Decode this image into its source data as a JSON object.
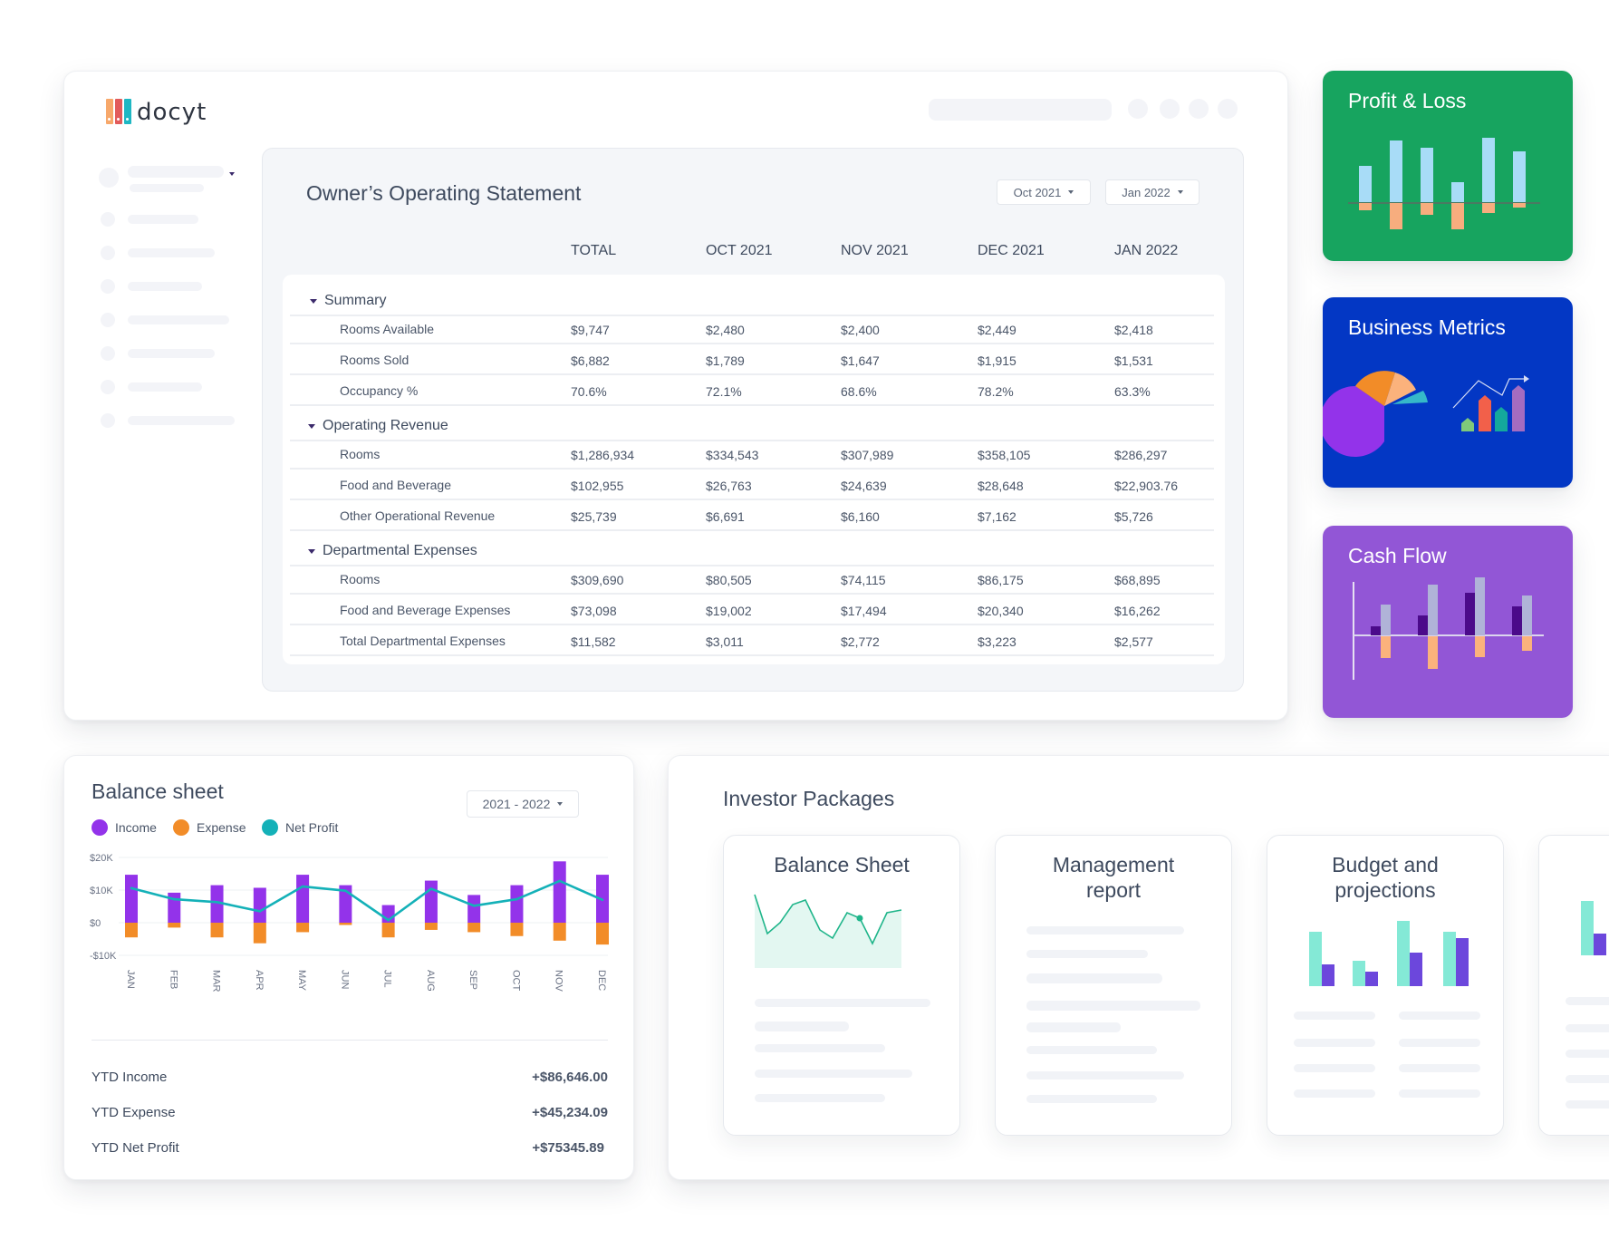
{
  "brand": {
    "name": "docyt",
    "logo_colors": [
      "#f7a86b",
      "#e25b5b",
      "#1fb7c3"
    ]
  },
  "statement": {
    "title": "Owner’s Operating Statement",
    "from_dropdown": "Oct 2021",
    "to_dropdown": "Jan 2022",
    "columns": [
      "TOTAL",
      "OCT 2021",
      "NOV 2021",
      "DEC 2021",
      "JAN 2022"
    ],
    "sections": [
      {
        "name": "Summary",
        "rows": [
          {
            "label": "Rooms Available",
            "values": [
              "$9,747",
              "$2,480",
              "$2,400",
              "$2,449",
              "$2,418"
            ]
          },
          {
            "label": "Rooms Sold",
            "values": [
              "$6,882",
              "$1,789",
              "$1,647",
              "$1,915",
              "$1,531"
            ]
          },
          {
            "label": "Occupancy %",
            "values": [
              "70.6%",
              "72.1%",
              "68.6%",
              "78.2%",
              "63.3%"
            ]
          }
        ]
      },
      {
        "name": "Operating Revenue",
        "rows": [
          {
            "label": "Rooms",
            "values": [
              "$1,286,934",
              "$334,543",
              "$307,989",
              "$358,105",
              "$286,297"
            ]
          },
          {
            "label": "Food and Beverage",
            "values": [
              "$102,955",
              "$26,763",
              "$24,639",
              "$28,648",
              "$22,903.76"
            ]
          },
          {
            "label": "Other Operational Revenue",
            "values": [
              "$25,739",
              "$6,691",
              "$6,160",
              "$7,162",
              "$5,726"
            ]
          }
        ]
      },
      {
        "name": "Departmental Expenses",
        "rows": [
          {
            "label": "Rooms",
            "values": [
              "$309,690",
              "$80,505",
              "$74,115",
              "$86,175",
              "$68,895"
            ]
          },
          {
            "label": "Food and Beverage Expenses",
            "values": [
              "$73,098",
              "$19,002",
              "$17,494",
              "$20,340",
              "$16,262"
            ]
          },
          {
            "label": "Total Departmental Expenses",
            "values": [
              "$11,582",
              "$3,011",
              "$2,772",
              "$3,223",
              "$2,577"
            ]
          }
        ]
      }
    ]
  },
  "side_cards": [
    {
      "title": "Profit & Loss",
      "color": "#17a45f"
    },
    {
      "title": "Business Metrics",
      "color": "#0337c4"
    },
    {
      "title": "Cash Flow",
      "color": "#9256d6"
    }
  ],
  "balance_sheet": {
    "title": "Balance sheet",
    "period_dropdown": "2021 - 2022",
    "legend": [
      {
        "label": "Income",
        "color": "#9333ea"
      },
      {
        "label": "Expense",
        "color": "#f28c28"
      },
      {
        "label": "Net Profit",
        "color": "#14b1b8"
      }
    ],
    "ytd": [
      {
        "label": "YTD Income",
        "value": "+$86,646.00"
      },
      {
        "label": "YTD Expense",
        "value": "+$45,234.09"
      },
      {
        "label": "YTD Net Profit",
        "value": "+$75345.89"
      }
    ]
  },
  "chart_data": {
    "type": "bar",
    "title": "Balance sheet",
    "xlabel": "",
    "ylabel": "",
    "categories": [
      "JAN",
      "FEB",
      "MAR",
      "APR",
      "MAY",
      "JUN",
      "JUL",
      "AUG",
      "SEP",
      "OCT",
      "NOV",
      "DEC"
    ],
    "y_ticks": [
      "$20K",
      "$10K",
      "$0",
      "-$10K"
    ],
    "y_tick_values": [
      20000,
      10000,
      0,
      -10000
    ],
    "ylim": [
      -10000,
      20000
    ],
    "grid": true,
    "legend_position": "top-left",
    "series": [
      {
        "name": "Income",
        "type": "bar",
        "values": [
          14700,
          9200,
          11500,
          10700,
          14700,
          11500,
          5400,
          12900,
          8500,
          11500,
          18800,
          14700
        ]
      },
      {
        "name": "Expense",
        "type": "bar",
        "values": [
          -4500,
          -1500,
          -4500,
          -6300,
          -2900,
          -700,
          -4500,
          -2200,
          -2900,
          -4100,
          -5500,
          -6700
        ]
      },
      {
        "name": "Net Profit",
        "type": "line",
        "values": [
          10600,
          7200,
          6300,
          3500,
          11100,
          9800,
          800,
          10400,
          5200,
          7200,
          12800,
          7000
        ]
      }
    ]
  },
  "investor_packages": {
    "title": "Investor Packages",
    "cards": [
      {
        "title": "Balance Sheet"
      },
      {
        "title": "Management report"
      },
      {
        "title": "Budget and projections"
      },
      {
        "title": ""
      }
    ]
  }
}
